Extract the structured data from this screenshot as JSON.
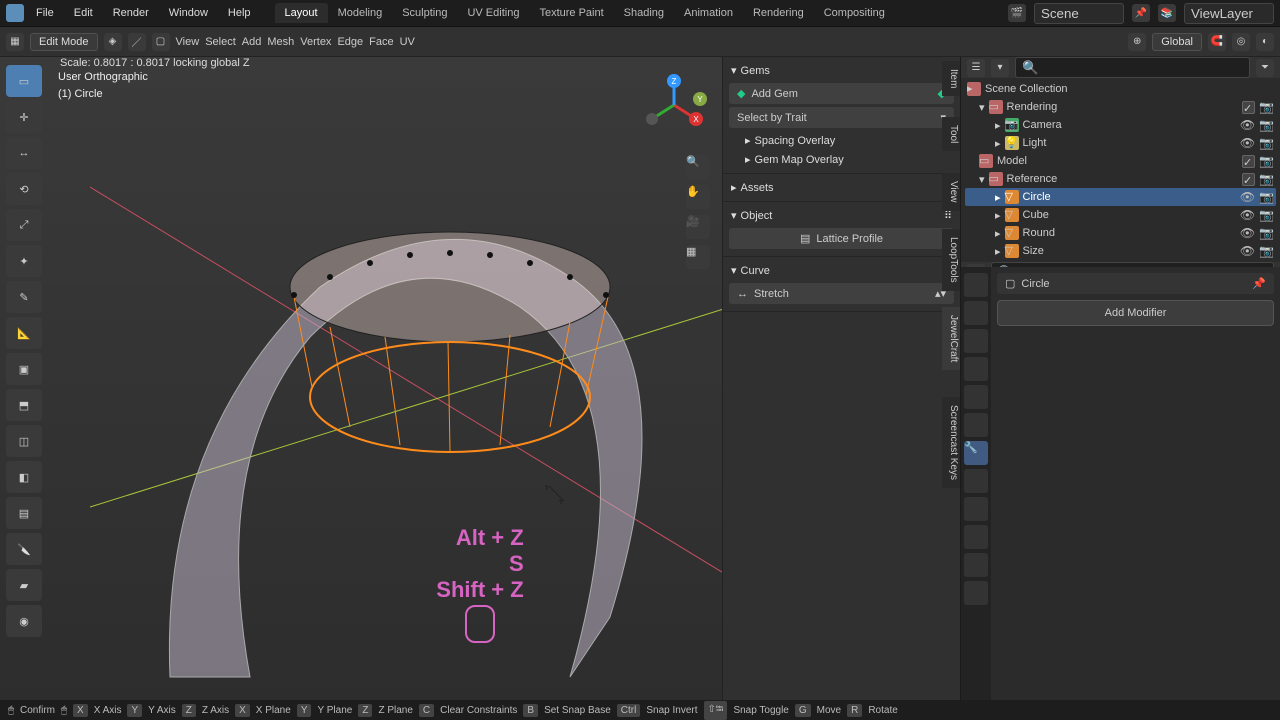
{
  "topbar": {
    "menus": [
      "File",
      "Edit",
      "Render",
      "Window",
      "Help"
    ],
    "workspaces": [
      "Layout",
      "Modeling",
      "Sculpting",
      "UV Editing",
      "Texture Paint",
      "Shading",
      "Animation",
      "Rendering",
      "Compositing"
    ],
    "active_workspace": "Layout",
    "scene": "Scene",
    "view_layer": "ViewLayer"
  },
  "tool_header": {
    "mode": "Edit Mode",
    "menus": [
      "View",
      "Select",
      "Add",
      "Mesh",
      "Vertex",
      "Edge",
      "Face",
      "UV"
    ],
    "orientation": "Global"
  },
  "status_line": "Scale: 0.8017 : 0.8017 locking global Z",
  "overlay": {
    "projection": "User Orthographic",
    "object": "(1) Circle"
  },
  "npanel": {
    "tabs": [
      "Item",
      "Tool",
      "View",
      "LoopTools",
      "JewelCraft",
      "Screencast Keys"
    ],
    "gems_title": "Gems",
    "add_gem": "Add Gem",
    "select_trait": "Select by Trait",
    "spacing": "Spacing Overlay",
    "gem_map": "Gem Map Overlay",
    "assets_title": "Assets",
    "object_title": "Object",
    "lattice": "Lattice Profile",
    "curve_title": "Curve",
    "stretch": "Stretch"
  },
  "keys": {
    "k1": "Alt + Z",
    "k2": "S",
    "k3": "Shift + Z"
  },
  "outliner": {
    "collection": "Scene Collection",
    "items": [
      {
        "name": "Rendering",
        "type": "collection",
        "indent": 0
      },
      {
        "name": "Camera",
        "type": "camera",
        "indent": 1
      },
      {
        "name": "Light",
        "type": "light",
        "indent": 1
      },
      {
        "name": "Model",
        "type": "collection",
        "indent": 0
      },
      {
        "name": "Reference",
        "type": "collection",
        "indent": 0
      },
      {
        "name": "Circle",
        "type": "mesh",
        "indent": 1,
        "active": true
      },
      {
        "name": "Cube",
        "type": "mesh",
        "indent": 1
      },
      {
        "name": "Round",
        "type": "mesh",
        "indent": 1
      },
      {
        "name": "Size",
        "type": "mesh",
        "indent": 1
      }
    ]
  },
  "properties": {
    "header_search": "",
    "object_name": "Circle",
    "add_modifier": "Add Modifier"
  },
  "statusbar": {
    "items": [
      {
        "key": "⏎",
        "label": "Confirm"
      },
      {
        "key": "X",
        "label": "X Axis"
      },
      {
        "key": "Y",
        "label": "Y Axis"
      },
      {
        "key": "Z",
        "label": "Z Axis"
      },
      {
        "key": "X",
        "label": "X Plane"
      },
      {
        "key": "Y",
        "label": "Y Plane"
      },
      {
        "key": "Z",
        "label": "Z Plane"
      },
      {
        "key": "C",
        "label": "Clear Constraints"
      },
      {
        "key": "B",
        "label": "Set Snap Base"
      },
      {
        "key": "Ctrl",
        "label": "Snap Invert"
      },
      {
        "key": "⇧⭾",
        "label": "Snap Toggle"
      },
      {
        "key": "G",
        "label": "Move"
      },
      {
        "key": "R",
        "label": "Rotate"
      }
    ]
  }
}
